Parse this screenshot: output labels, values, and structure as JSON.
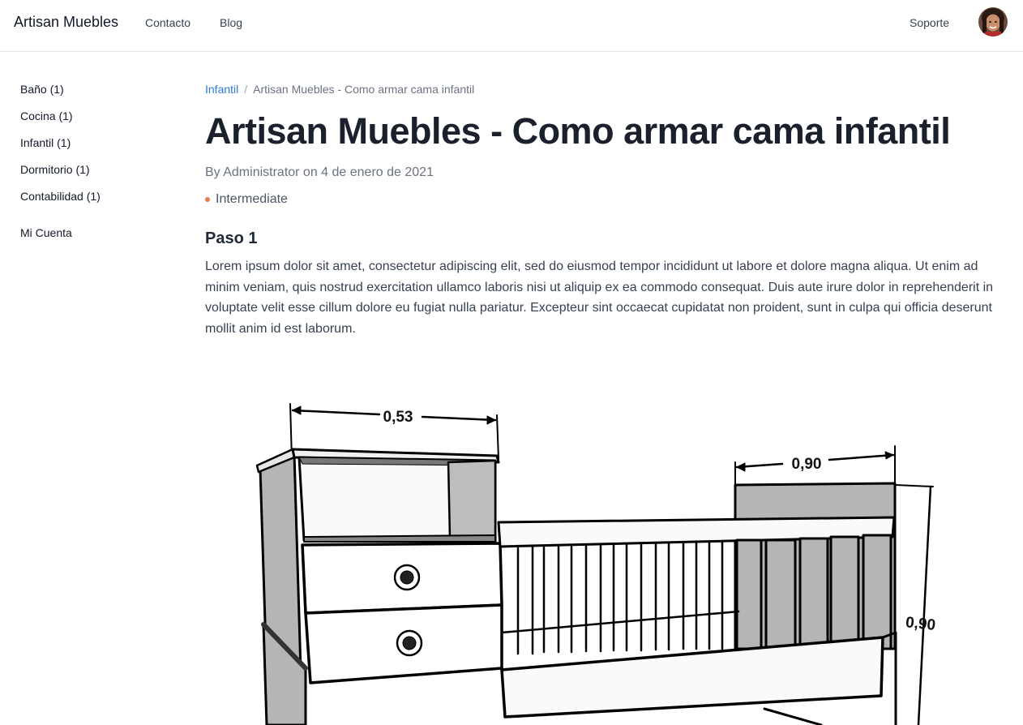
{
  "header": {
    "brand": "Artisan Muebles",
    "nav": [
      {
        "label": "Contacto"
      },
      {
        "label": "Blog"
      }
    ],
    "support_label": "Soporte"
  },
  "sidebar": {
    "categories": [
      {
        "label": "Baño (1)"
      },
      {
        "label": "Cocina (1)"
      },
      {
        "label": "Infantil (1)"
      },
      {
        "label": "Dormitorio (1)"
      },
      {
        "label": "Contabilidad (1)"
      }
    ],
    "account_label": "Mi Cuenta"
  },
  "breadcrumb": {
    "parent": "Infantil",
    "separator": "/",
    "current": "Artisan Muebles - Como armar cama infantil"
  },
  "article": {
    "title": "Artisan Muebles - Como armar cama infantil",
    "byline": "By Administrator on 4 de enero de 2021",
    "level": "Intermediate",
    "level_color": "#f07a4a",
    "step": {
      "title": "Paso 1",
      "text": "Lorem ipsum dolor sit amet, consectetur adipiscing elit, sed do eiusmod tempor incididunt ut labore et dolore magna aliqua. Ut enim ad minim veniam, quis nostrud exercitation ullamco laboris nisi ut aliquip ex ea commodo consequat. Duis aute irure dolor in reprehenderit in voluptate velit esse cillum dolore eu fugiat nulla pariatur. Excepteur sint occaecat cupidatat non proident, sunt in culpa qui officia deserunt mollit anim id est laborum."
    },
    "diagram_labels": {
      "shelf_width": "0,53",
      "crib_width": "0,90",
      "crib_height": "0,90"
    }
  },
  "colors": {
    "link": "#2b7bd8",
    "title": "#1a202c"
  }
}
